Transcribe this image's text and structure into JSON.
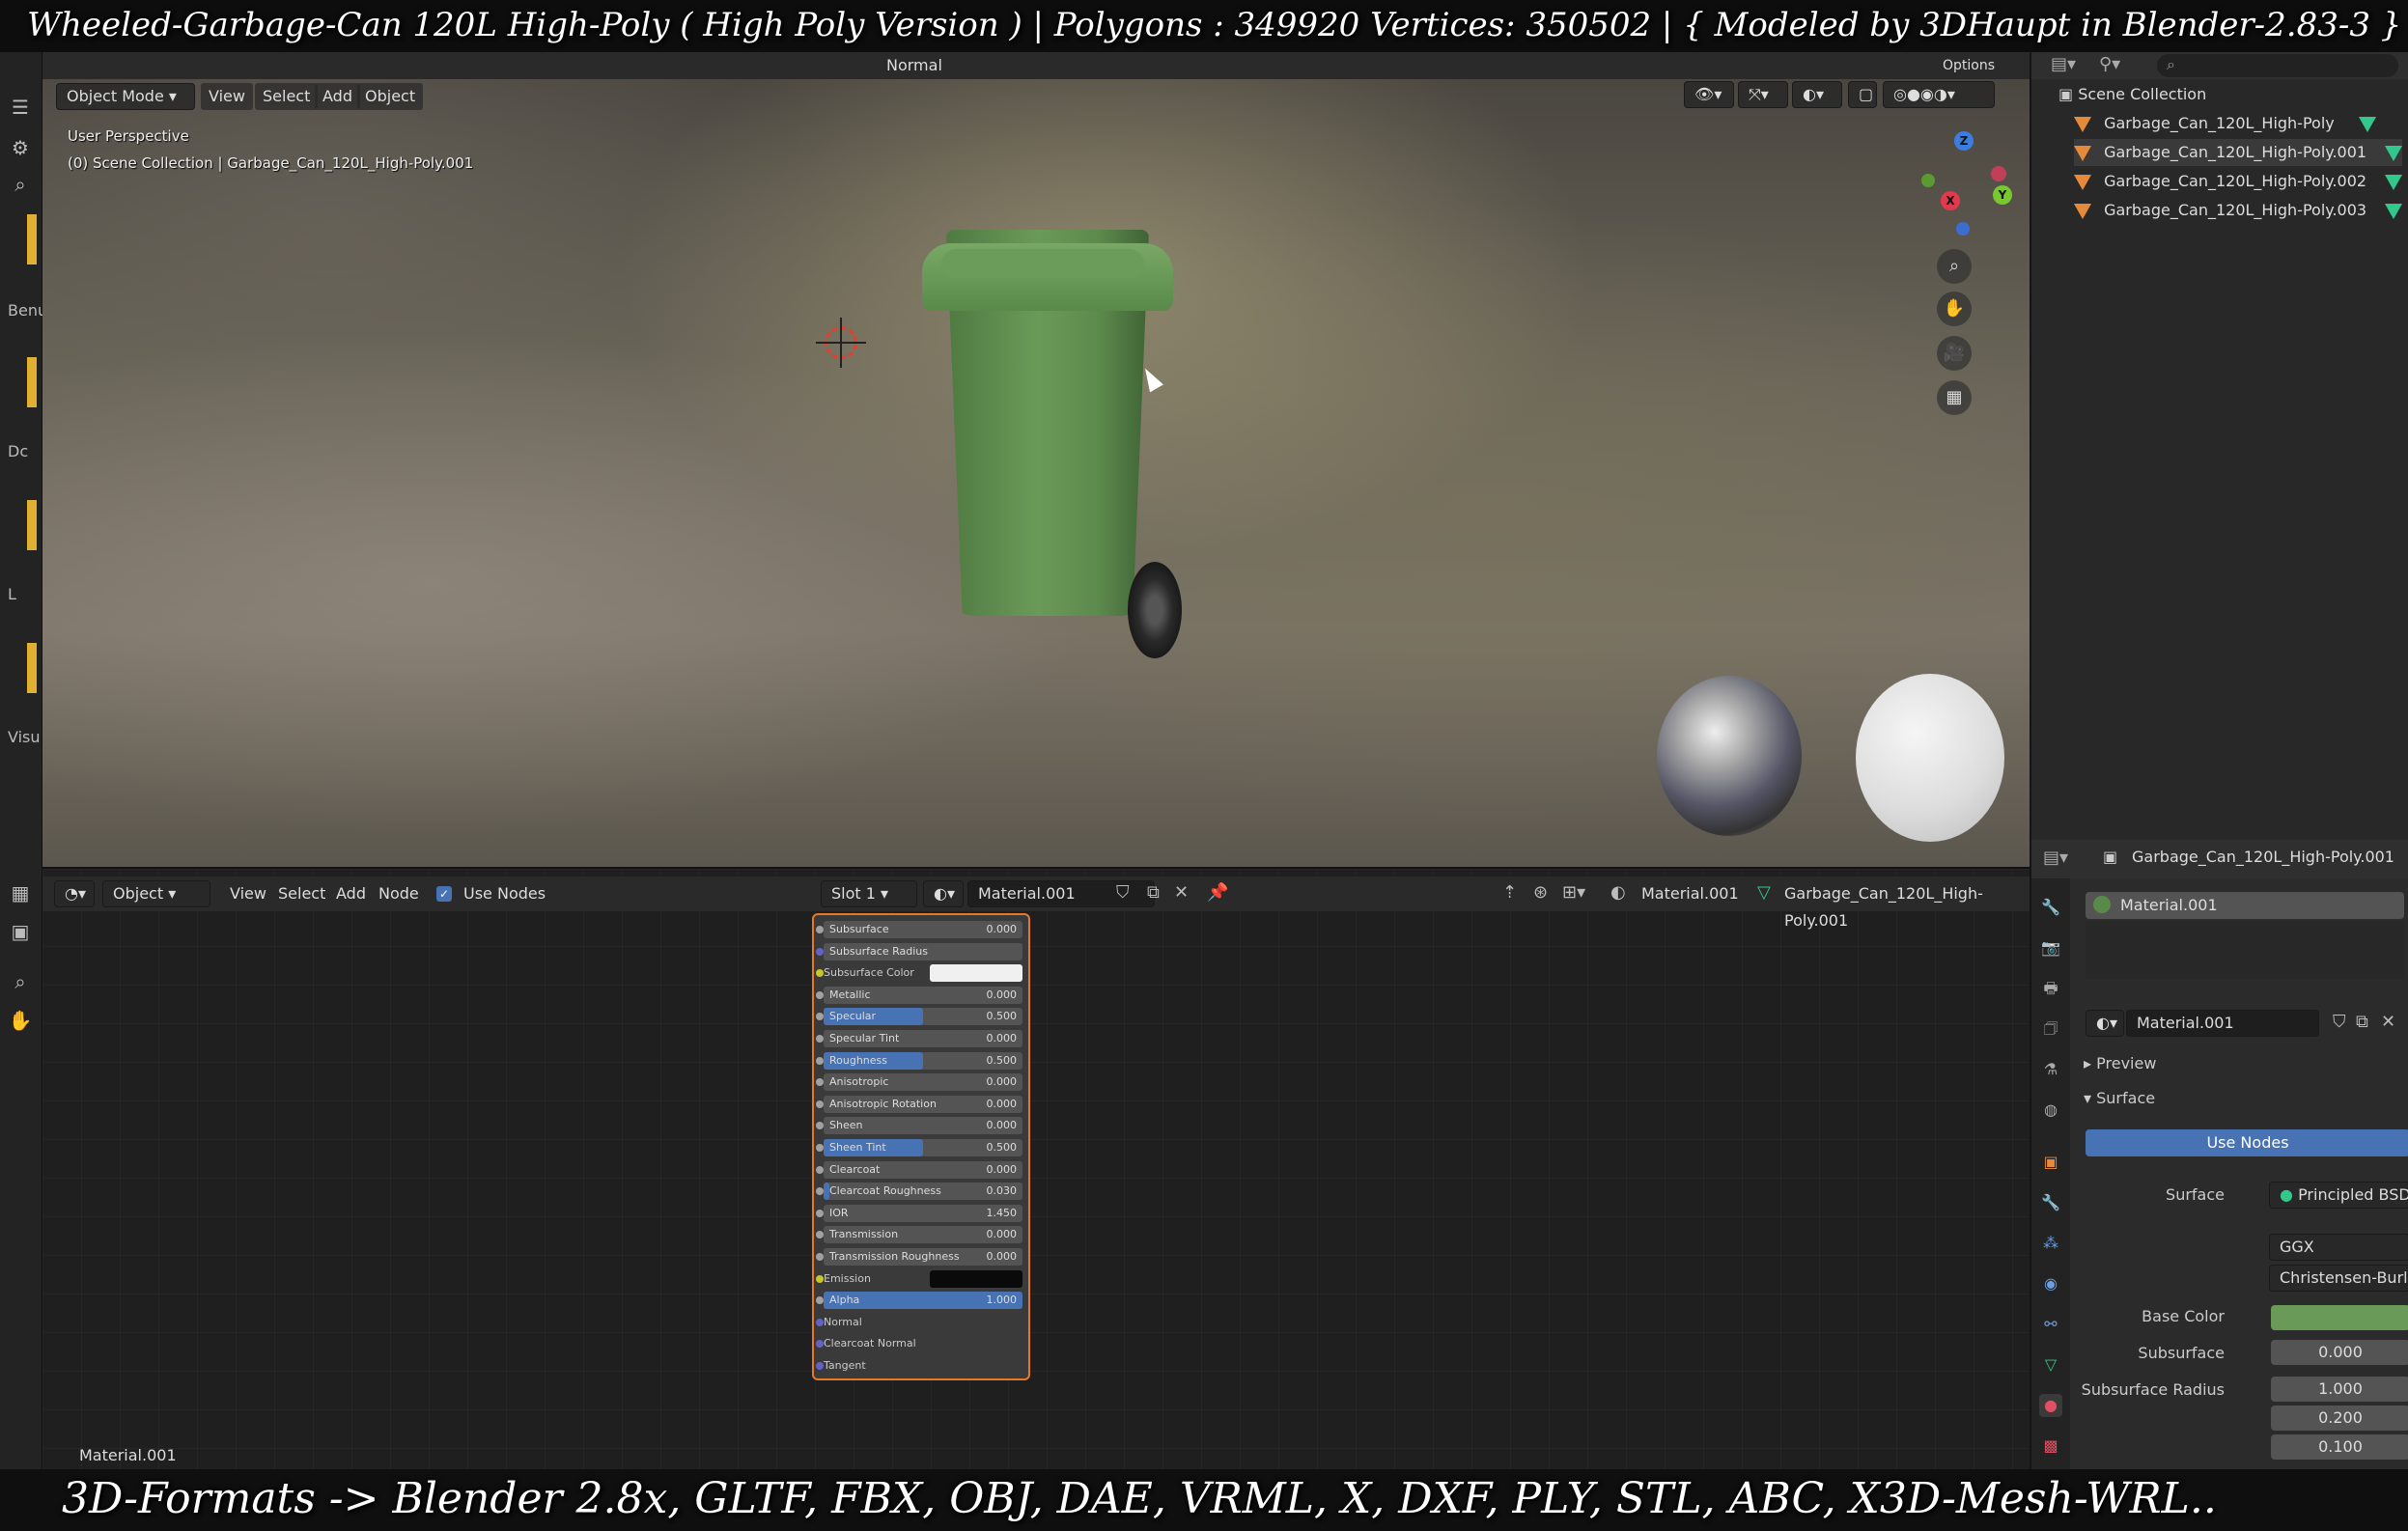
{
  "captions": {
    "top": "Wheeled-Garbage-Can 120L High-Poly ( High Poly Version )  |   Polygons : 349920  Vertices: 350502    |    { Modeled by 3DHaupt in Blender-2.83-3 }",
    "bottom": "3D-Formats -> Blender 2.8x, GLTF, FBX, OBJ, DAE, VRML, X, DXF, PLY, STL, ABC, X3D-Mesh-WRL.."
  },
  "left_strip": {
    "labels": [
      "Benu",
      "Dc",
      "L",
      "Visu"
    ]
  },
  "viewport": {
    "header": {
      "mode": "Object Mode",
      "menus": [
        "View",
        "Select",
        "Add",
        "Object"
      ],
      "orientation": "Normal",
      "options": "Options"
    },
    "perspective_label": "User Perspective",
    "collection_path": "(0) Scene Collection | Garbage_Can_120L_High-Poly.001"
  },
  "gizmo": {
    "x": "X",
    "y": "Y",
    "z": "Z"
  },
  "outliner": {
    "root": "Scene Collection",
    "items": [
      "Garbage_Can_120L_High-Poly",
      "Garbage_Can_120L_High-Poly.001",
      "Garbage_Can_120L_High-Poly.002",
      "Garbage_Can_120L_High-Poly.003"
    ]
  },
  "node_editor": {
    "header": {
      "type": "Object",
      "menus": [
        "View",
        "Select",
        "Add",
        "Node"
      ],
      "use_nodes": "Use Nodes",
      "slot": "Slot 1",
      "material": "Material.001",
      "breadcrumb_material": "Material.001",
      "breadcrumb_object": "Garbage_Can_120L_High-Poly.001"
    },
    "footer_label": "Material.001",
    "sockets": [
      {
        "label": "Subsurface",
        "value": "0.000",
        "kind": "num",
        "fill": 0,
        "sock": "g"
      },
      {
        "label": "Subsurface Radius",
        "value": "",
        "kind": "drop",
        "fill": 0,
        "sock": "p"
      },
      {
        "label": "Subsurface Color",
        "value": "",
        "kind": "color-white",
        "fill": 0,
        "sock": "y"
      },
      {
        "label": "Metallic",
        "value": "0.000",
        "kind": "num",
        "fill": 0,
        "sock": "g"
      },
      {
        "label": "Specular",
        "value": "0.500",
        "kind": "num",
        "fill": 0.5,
        "sock": "g"
      },
      {
        "label": "Specular Tint",
        "value": "0.000",
        "kind": "num",
        "fill": 0,
        "sock": "g"
      },
      {
        "label": "Roughness",
        "value": "0.500",
        "kind": "num",
        "fill": 0.5,
        "sock": "g"
      },
      {
        "label": "Anisotropic",
        "value": "0.000",
        "kind": "num",
        "fill": 0,
        "sock": "g"
      },
      {
        "label": "Anisotropic Rotation",
        "value": "0.000",
        "kind": "num",
        "fill": 0,
        "sock": "g"
      },
      {
        "label": "Sheen",
        "value": "0.000",
        "kind": "num",
        "fill": 0,
        "sock": "g"
      },
      {
        "label": "Sheen Tint",
        "value": "0.500",
        "kind": "num",
        "fill": 0.5,
        "sock": "g"
      },
      {
        "label": "Clearcoat",
        "value": "0.000",
        "kind": "num",
        "fill": 0,
        "sock": "g"
      },
      {
        "label": "Clearcoat Roughness",
        "value": "0.030",
        "kind": "num",
        "fill": 0.03,
        "sock": "g"
      },
      {
        "label": "IOR",
        "value": "1.450",
        "kind": "num",
        "fill": 0,
        "sock": "g"
      },
      {
        "label": "Transmission",
        "value": "0.000",
        "kind": "num",
        "fill": 0,
        "sock": "g"
      },
      {
        "label": "Transmission Roughness",
        "value": "0.000",
        "kind": "num",
        "fill": 0,
        "sock": "g"
      },
      {
        "label": "Emission",
        "value": "",
        "kind": "color-black",
        "fill": 0,
        "sock": "y"
      },
      {
        "label": "Alpha",
        "value": "1.000",
        "kind": "num",
        "fill": 1,
        "sock": "g"
      },
      {
        "label": "Normal",
        "value": "",
        "kind": "label",
        "fill": 0,
        "sock": "p"
      },
      {
        "label": "Clearcoat Normal",
        "value": "",
        "kind": "label",
        "fill": 0,
        "sock": "p"
      },
      {
        "label": "Tangent",
        "value": "",
        "kind": "label",
        "fill": 0,
        "sock": "p"
      }
    ]
  },
  "properties": {
    "object_name": "Garbage_Can_120L_High-Poly.001",
    "material_slot": "Material.001",
    "material_name": "Material.001",
    "panels": {
      "preview": "Preview",
      "surface": "Surface"
    },
    "use_nodes": "Use Nodes",
    "surface_label": "Surface",
    "surface_value": "Principled BSDF",
    "distribution": "GGX",
    "subsurface_method": "Christensen-Burley",
    "base_color_label": "Base Color",
    "base_color": "#6a9a58",
    "subsurface_label": "Subsurface",
    "subsurface_value": "0.000",
    "subsurface_radius_label": "Subsurface Radius",
    "subsurface_radius": [
      "1.000",
      "0.200",
      "0.100"
    ]
  }
}
